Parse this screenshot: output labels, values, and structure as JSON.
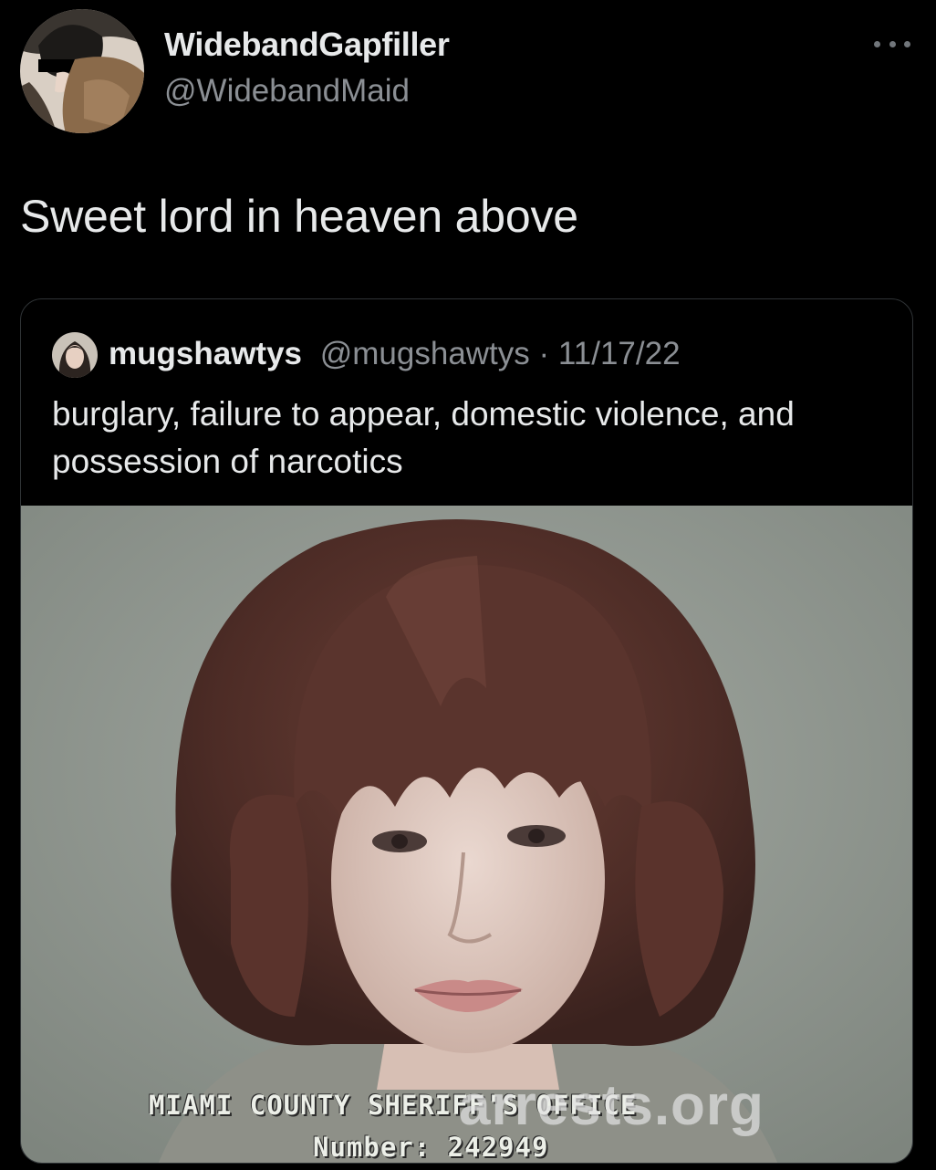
{
  "tweet": {
    "display_name": "WidebandGapfiller",
    "handle": "@WidebandMaid",
    "text": "Sweet lord in heaven above",
    "more_icon": "more-horizontal-icon"
  },
  "quoted_tweet": {
    "display_name": "mugshawtys",
    "handle": "@mugshawtys",
    "separator": " · ",
    "date": "11/17/22",
    "text": "burglary, failure to appear, domestic violence, and possession of narcotics",
    "photo": {
      "caption_line1": "MIAMI COUNTY SHERIFF'S OFFICE",
      "caption_line2": "Number: 242949",
      "watermark": "arrests.org"
    }
  },
  "colors": {
    "background": "#000000",
    "primary_text": "#e7e9ea",
    "secondary_text": "#8b8f94",
    "border": "#2f3336"
  }
}
